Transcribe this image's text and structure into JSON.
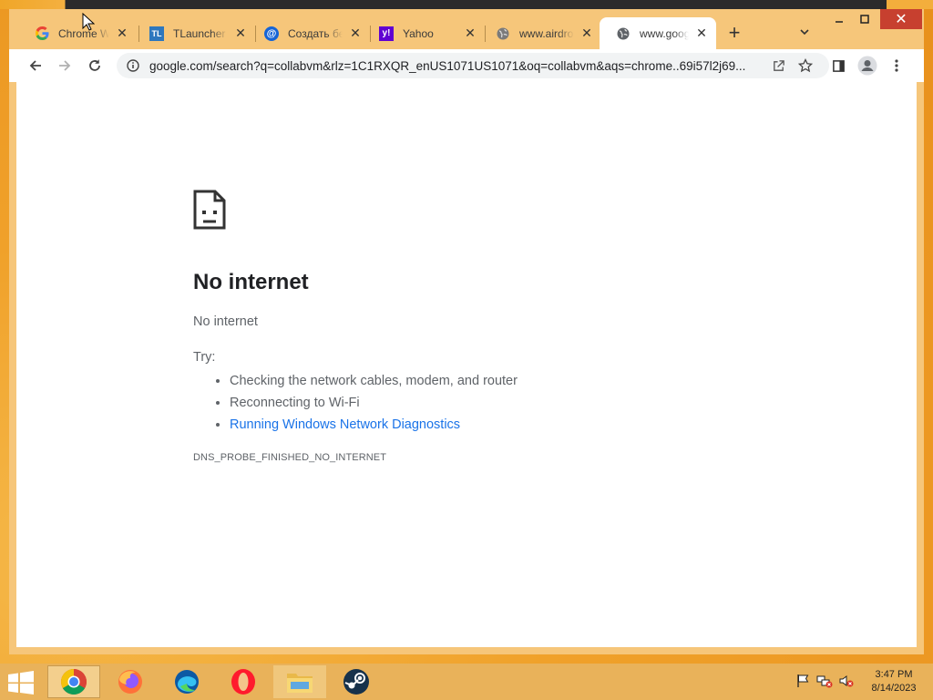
{
  "browser": {
    "tabs": [
      {
        "title": "Chrome Web Store",
        "favicon": "google-icon",
        "active": false
      },
      {
        "title": "TLauncher - ",
        "favicon": "tlauncher-icon",
        "favicon_text": "TL",
        "active": false
      },
      {
        "title": "Создать бесплатную",
        "favicon": "at-mail-icon",
        "favicon_text": "@",
        "active": false
      },
      {
        "title": "Yahoo",
        "favicon": "yahoo-icon",
        "favicon_text": "y!",
        "active": false
      },
      {
        "title": "www.airdroid.com",
        "favicon": "globe-icon",
        "active": false
      },
      {
        "title": "www.google.com",
        "favicon": "globe-icon",
        "active": true
      }
    ],
    "url": "google.com/search?q=collabvm&rlz=1C1RXQR_enUS1071US1071&oq=collabvm&aqs=chrome..69i57l2j69..."
  },
  "error_page": {
    "title": "No internet",
    "subtitle": "No internet",
    "try_label": "Try:",
    "suggestions": [
      "Checking the network cables, modem, and router",
      "Reconnecting to Wi-Fi",
      "Running Windows Network Diagnostics"
    ],
    "error_code": "DNS_PROBE_FINISHED_NO_INTERNET"
  },
  "taskbar": {
    "apps": [
      "chrome-icon",
      "firefox-icon",
      "edge-icon",
      "opera-icon",
      "file-explorer-icon",
      "steam-icon"
    ],
    "clock_time": "3:47 PM",
    "clock_date": "8/14/2023"
  },
  "colors": {
    "accent_frame": "#f6c67a",
    "link": "#1a73e8",
    "close_button": "#c7402f"
  }
}
